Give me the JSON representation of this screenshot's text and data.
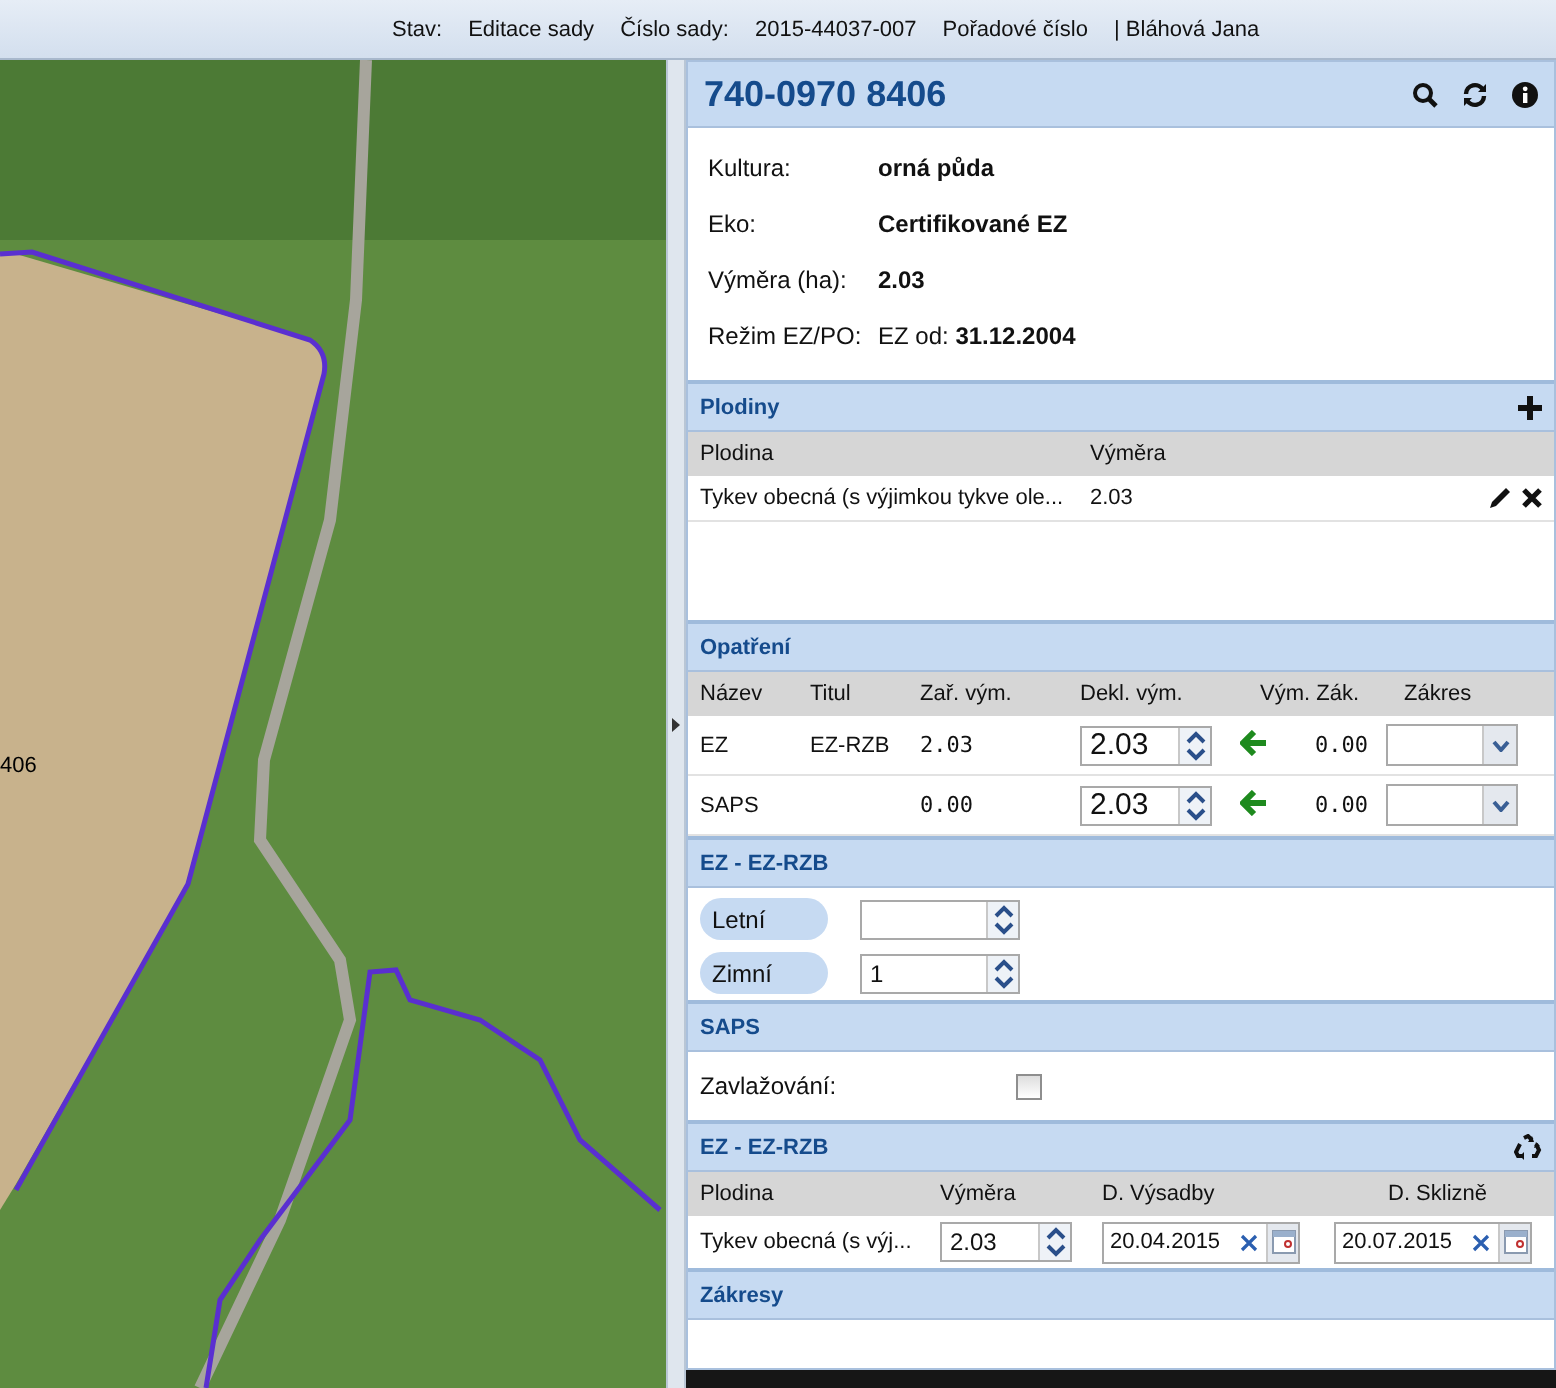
{
  "status_bar": {
    "items": [
      "Stav:",
      "Editace sady",
      "Číslo sady:",
      "2015-44037-007",
      "Pořadové číslo",
      "| Bláhová Jana"
    ]
  },
  "map": {
    "parcel_label": "406"
  },
  "detail": {
    "title": "740-0970 8406",
    "info": [
      {
        "label": "Kultura:",
        "value": "orná půda",
        "bold": true
      },
      {
        "label": "Eko:",
        "value": "Certifikované EZ",
        "bold": true
      },
      {
        "label": "Výměra (ha):",
        "value": "2.03",
        "bold": true
      },
      {
        "label": "Režim EZ/PO:",
        "value": "EZ od: **31.12.2004**",
        "bold": false
      }
    ]
  },
  "plodiny": {
    "title": "Plodiny",
    "columns": [
      "Plodina",
      "Výměra"
    ],
    "rows": [
      {
        "plodina": "Tykev obecná (s výjimkou tykve ole...",
        "vymera": "2.03"
      }
    ]
  },
  "opatreni": {
    "title": "Opatření",
    "columns": [
      "Název",
      "Titul",
      "Zař. vým.",
      "Dekl. vým.",
      "Vým. Zák.",
      "Zákres"
    ],
    "rows": [
      {
        "nazev": "EZ",
        "titul": "EZ-RZB",
        "zar_vym": "2.03",
        "dekl_vym": "2.03",
        "vym_zak": "0.00"
      },
      {
        "nazev": "SAPS",
        "zar_vym": "0.00",
        "dekl_vym": "2.03",
        "vym_zak": "0.00"
      }
    ]
  },
  "ez_rzb": {
    "title": "EZ - EZ-RZB",
    "fields": [
      {
        "label": "Letní"
      },
      {
        "label": "Zimní",
        "value": "1"
      }
    ]
  },
  "saps": {
    "title": "SAPS",
    "checkbox": {
      "label": "Zavlažování:",
      "checked": false
    }
  },
  "ez_rzb_plodiny": {
    "title": "EZ - EZ-RZB",
    "columns": [
      "Plodina",
      "Výměra",
      "D. Výsadby",
      "D. Sklizně"
    ],
    "rows": [
      {
        "plodina": "Tykev obecná (s výj...",
        "vymera": "2.03",
        "d_vysadby": "20.04.2015",
        "d_sklizne": "20.07.2015"
      }
    ]
  },
  "zakresy": {
    "title": "Zákresy"
  }
}
